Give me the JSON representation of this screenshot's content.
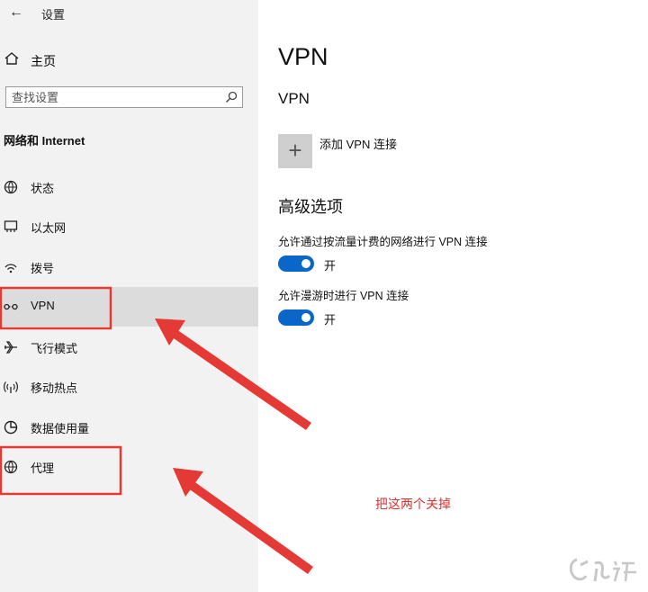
{
  "app": {
    "title": "设置",
    "back_icon": "back-arrow-icon"
  },
  "sidebar": {
    "home_label": "主页",
    "search_placeholder": "查找设置",
    "section_heading": "网络和 Internet",
    "items": [
      {
        "label": "状态",
        "icon": "globe-status-icon"
      },
      {
        "label": "以太网",
        "icon": "ethernet-icon"
      },
      {
        "label": "拨号",
        "icon": "dialup-icon"
      },
      {
        "label": "VPN",
        "icon": "vpn-icon",
        "selected": true
      },
      {
        "label": "飞行模式",
        "icon": "airplane-icon"
      },
      {
        "label": "移动热点",
        "icon": "hotspot-icon"
      },
      {
        "label": "数据使用量",
        "icon": "data-usage-icon"
      },
      {
        "label": "代理",
        "icon": "globe-icon"
      }
    ]
  },
  "main": {
    "title": "VPN",
    "subtitle": "VPN",
    "add_vpn_label": "添加 VPN 连接",
    "advanced_title": "高级选项",
    "options": [
      {
        "label": "允许通过按流量计费的网络进行 VPN 连接",
        "state": "开",
        "on": true
      },
      {
        "label": "允许漫游时进行 VPN 连接",
        "state": "开",
        "on": true
      }
    ]
  },
  "annotation": {
    "note": "把这两个关掉",
    "color": "#e03030"
  },
  "colors": {
    "accent": "#0a66c8",
    "sidebar_bg": "#f2f2f2",
    "selected_bg": "#dcdcdc"
  }
}
